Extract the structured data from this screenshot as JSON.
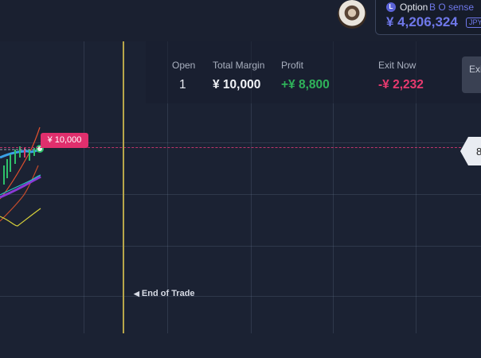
{
  "account": {
    "badge": "L",
    "type": "Option",
    "name": "B O sense",
    "balance": "¥ 4,206,324",
    "currency": "JPY"
  },
  "stats": {
    "open_label": "Open",
    "open_value": "1",
    "margin_label": "Total Margin",
    "margin_value": "¥ 10,000",
    "profit_label": "Profit",
    "profit_value": "+¥ 8,800",
    "exit_label": "Exit Now",
    "exit_value": "-¥ 2,232"
  },
  "exit_button_label": "Exi",
  "chart": {
    "price_tag": "¥ 10,000",
    "right_marker": "8",
    "end_of_trade": "End of Trade",
    "colors": {
      "profit": "#2fb35a",
      "loss": "#e83a6f",
      "accent": "#6f78ea",
      "expiry": "#b8a64a"
    }
  }
}
